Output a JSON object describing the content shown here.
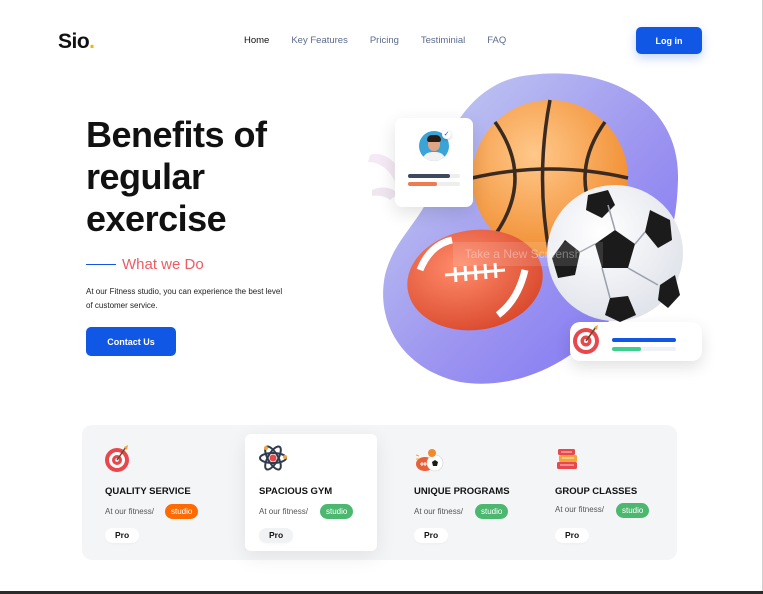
{
  "brand": {
    "name": "Sio",
    "dot": "."
  },
  "nav": {
    "items": [
      {
        "label": "Home",
        "active": true
      },
      {
        "label": "Key Features",
        "active": false
      },
      {
        "label": "Pricing",
        "active": false
      },
      {
        "label": "Testiminial",
        "active": false
      },
      {
        "label": "FAQ",
        "active": false
      }
    ],
    "login_label": "Log in"
  },
  "hero": {
    "title_line1": "Benefits of",
    "title_line2": "regular",
    "title_line3": "exercise",
    "subheading": "What we Do",
    "description": "At our Fitness studio, you can experience the best level of customer service.",
    "cta_label": "Contact Us",
    "watermark": "Take a New Screenshot"
  },
  "colors": {
    "accent": "#1057e5",
    "highlight": "#ee5a63",
    "badge_orange": "#ff6b00",
    "badge_green": "#4cb86f"
  },
  "features": [
    {
      "title": "QUALITY SERVICE",
      "desc": "At our fitness/",
      "badge": "studio",
      "badge_color": "orange",
      "tier": "Pro",
      "icon": "target-icon"
    },
    {
      "title": "SPACIOUS GYM",
      "desc": "At our fitness/",
      "badge": "studio",
      "badge_color": "green",
      "tier": "Pro",
      "icon": "atom-icon"
    },
    {
      "title": "UNIQUE PROGRAMS",
      "desc": "At our fitness/",
      "badge": "studio",
      "badge_color": "green",
      "tier": "Pro",
      "icon": "sports-balls-icon"
    },
    {
      "title": "GROUP CLASSES",
      "desc": "At our fitness/",
      "badge": "studio",
      "badge_color": "green",
      "tier": "Pro",
      "icon": "books-icon"
    }
  ]
}
